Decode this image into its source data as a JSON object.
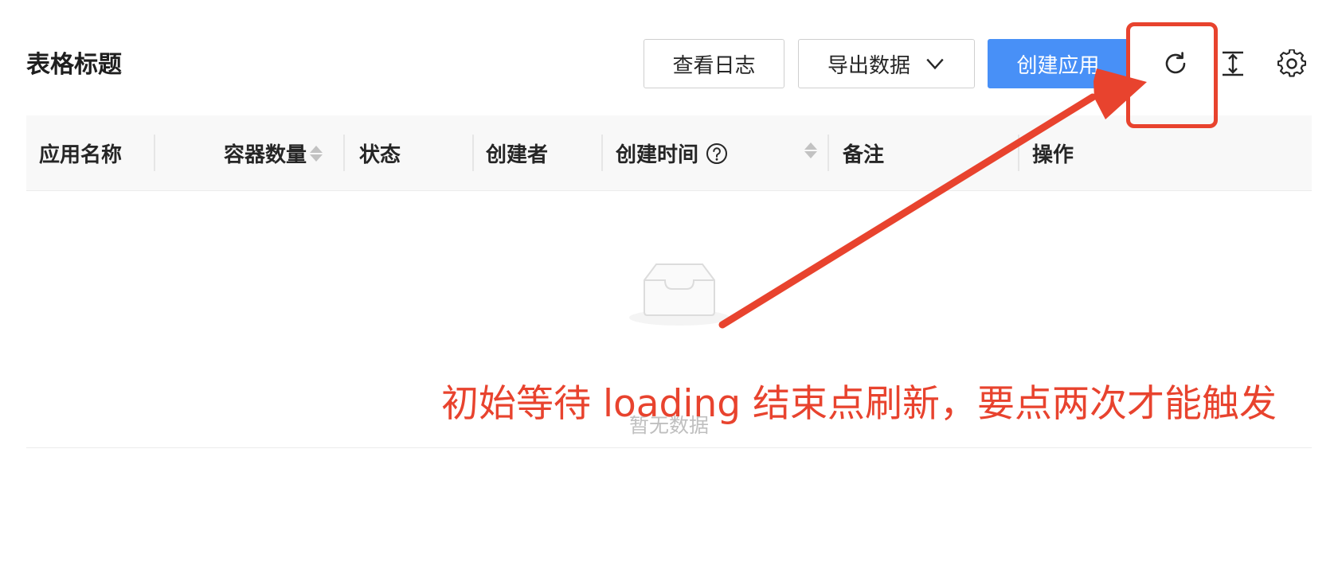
{
  "toolbar": {
    "title": "表格标题",
    "view_log_label": "查看日志",
    "export_label": "导出数据",
    "create_label": "创建应用",
    "icons": {
      "refresh": "refresh-icon",
      "density": "column-height-icon",
      "settings": "settings-icon",
      "export_dropdown": "chevron-down-icon"
    }
  },
  "table": {
    "columns": [
      {
        "label": "应用名称",
        "sortable": false
      },
      {
        "label": "容器数量",
        "sortable": true
      },
      {
        "label": "状态",
        "sortable": false
      },
      {
        "label": "创建者",
        "sortable": false
      },
      {
        "label": "创建时间",
        "sortable": true,
        "tooltip_icon": "question-circle-icon"
      },
      {
        "label": "备注",
        "sortable": false
      },
      {
        "label": "操作",
        "sortable": false
      }
    ],
    "rows": [],
    "empty_text": "暂无数据"
  },
  "annotation": {
    "text": "初始等待 loading 结束点刷新，要点两次才能触发",
    "color": "#e8432e"
  },
  "colors": {
    "primary": "#4890f7",
    "header_bg": "#f8f8f8",
    "annotation": "#e8432e"
  }
}
